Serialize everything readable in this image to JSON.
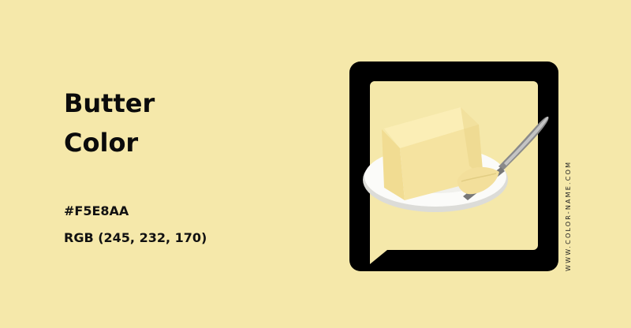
{
  "colors": {
    "background": "#F5E8AA",
    "frame": "#000000",
    "butter": "#F5E8AA"
  },
  "title": {
    "line1": "Butter",
    "line2": "Color"
  },
  "hex_code": "#F5E8AA",
  "rgb_value": "RGB (245, 232, 170)",
  "site_label": "WWW.COLOR-NAME.COM",
  "illustration": {
    "subject": "butter on plate with knife"
  }
}
